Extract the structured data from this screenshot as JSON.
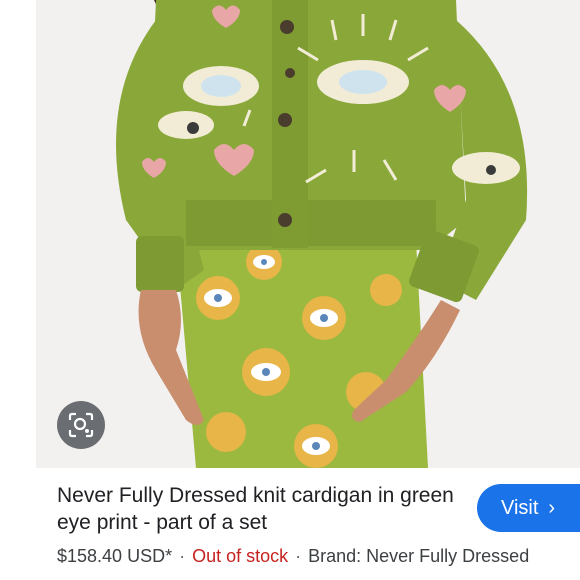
{
  "product": {
    "title": "Never Fully Dressed knit cardigan in green eye print - part of a set",
    "price": "$158.40 USD*",
    "stock_status": "Out of stock",
    "brand": "Brand: Never Fully Dressed",
    "separator": "·"
  },
  "actions": {
    "visit_label": "Visit",
    "visit_chevron": "›",
    "lens_icon": "lens-search-icon"
  },
  "colors": {
    "cardigan_green": "#8aa83a",
    "skirt_green": "#9bb83f",
    "link_blue": "#1a73e8",
    "out_of_stock_red": "#c5221f"
  }
}
